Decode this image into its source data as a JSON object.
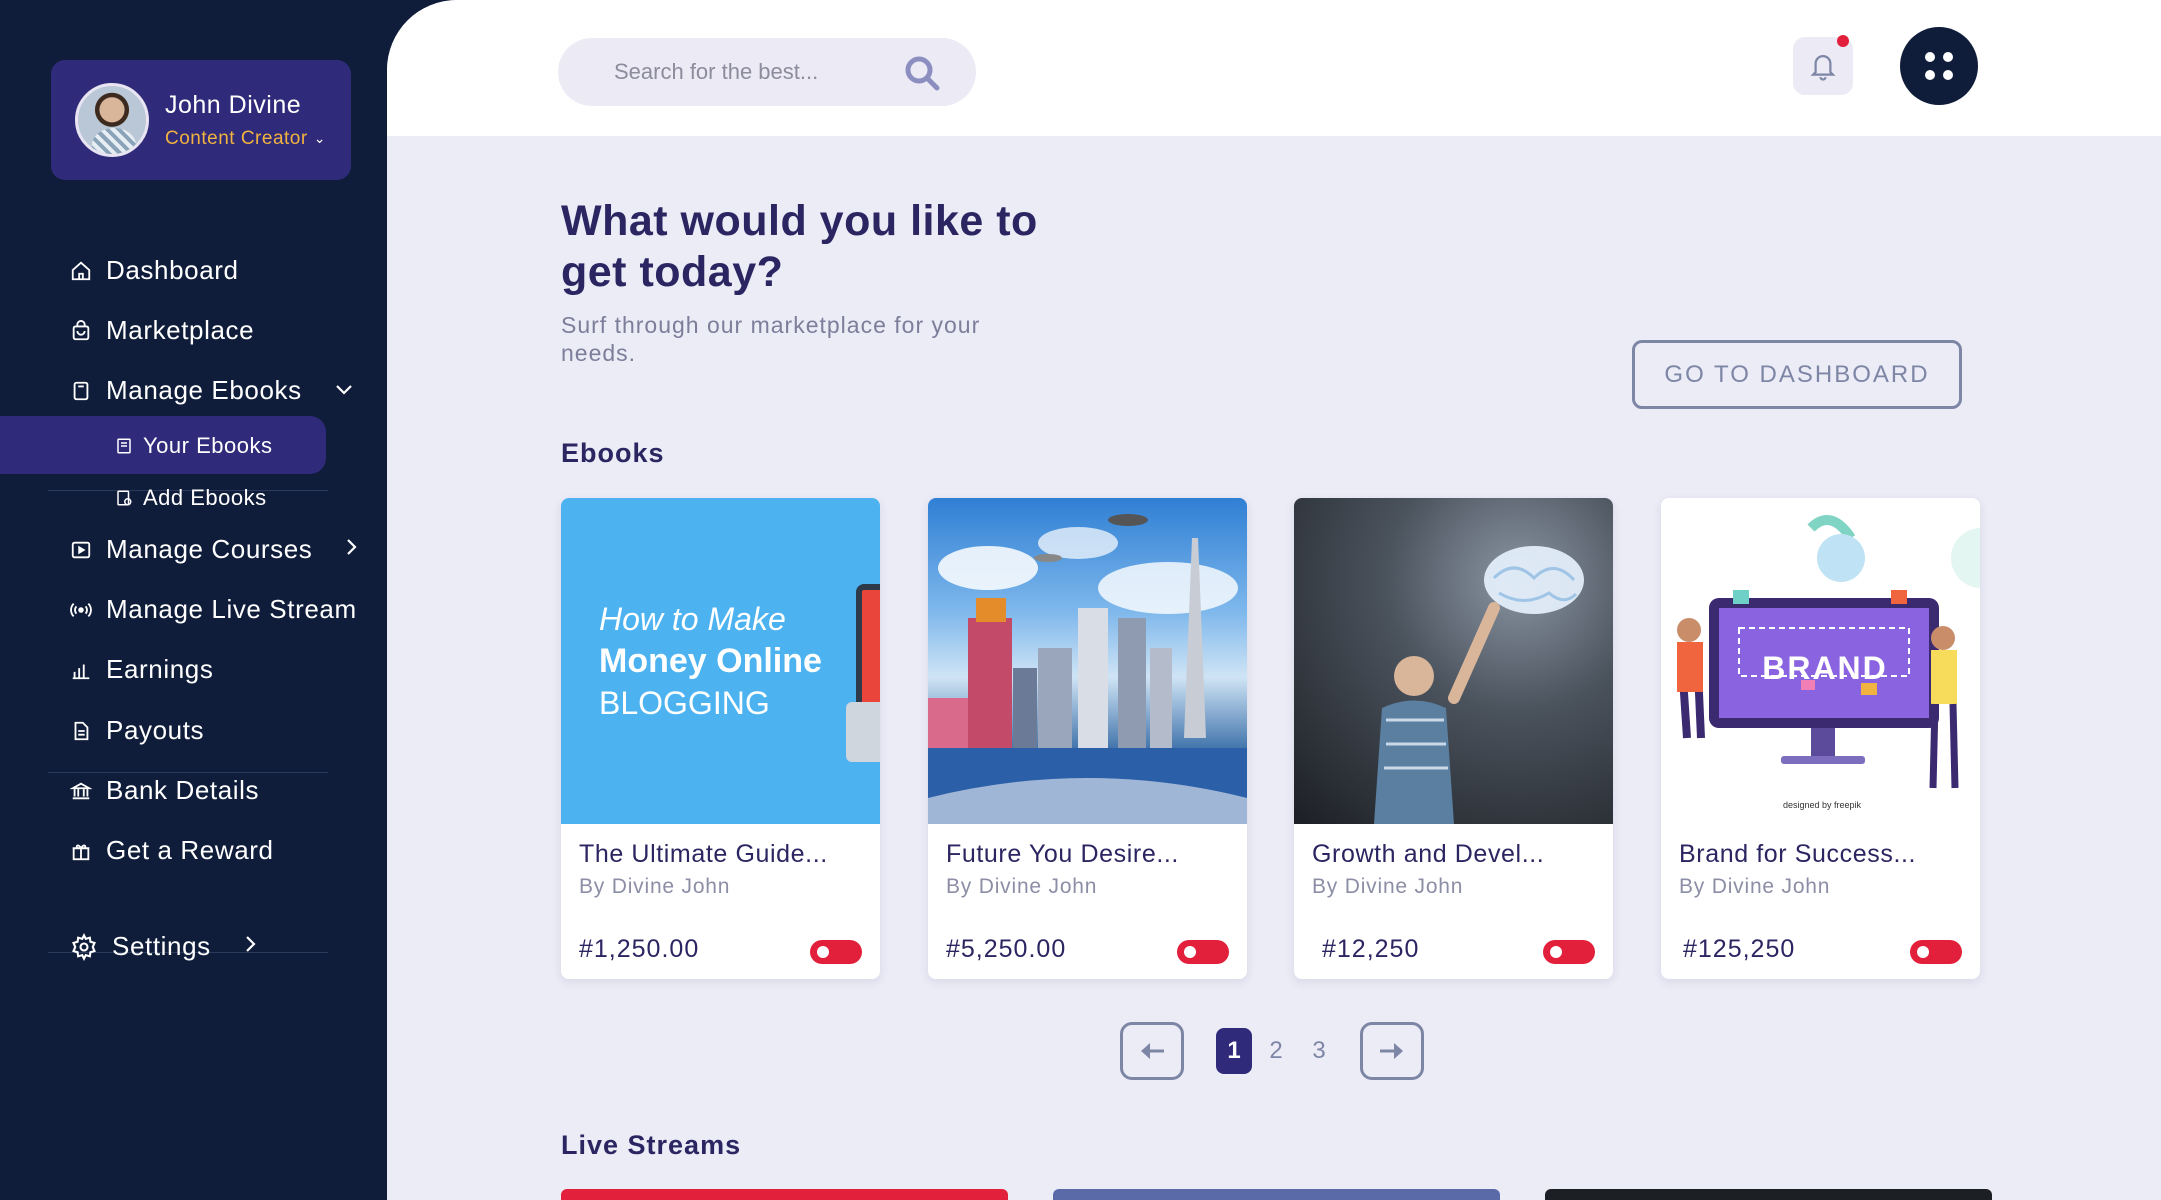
{
  "profile": {
    "name": "John Divine",
    "role": "Content Creator"
  },
  "nav": {
    "dashboard": "Dashboard",
    "marketplace": "Marketplace",
    "manage_ebooks": "Manage Ebooks",
    "your_ebooks": "Your Ebooks",
    "add_ebooks": "Add Ebooks",
    "manage_courses": "Manage Courses",
    "manage_live_stream": "Manage Live Stream",
    "earnings": "Earnings",
    "payouts": "Payouts",
    "bank_details": "Bank Details",
    "get_reward": "Get a Reward",
    "settings": "Settings"
  },
  "search": {
    "placeholder": "Search for the best..."
  },
  "hero": {
    "title": "What would you like to get today?",
    "subtitle": "Surf through our marketplace for your needs.",
    "cta": "GO TO DASHBOARD"
  },
  "ebooks": {
    "title": "Ebooks",
    "items": [
      {
        "title": "The Ultimate Guide...",
        "author": "By Divine John",
        "price": "#1,250.00",
        "cover_line1": "How to Make",
        "cover_line2": "Money Online",
        "cover_line3": "BLOGGING"
      },
      {
        "title": "Future You Desire...",
        "author": "By Divine John",
        "price": "#5,250.00"
      },
      {
        "title": "Growth and Devel...",
        "author": "By Divine John",
        "price": "#12,250"
      },
      {
        "title": "Brand for Success...",
        "author": "By Divine John",
        "price": "#125,250",
        "cover_brand": "BRAND",
        "cover_credit": "designed by freepik"
      }
    ]
  },
  "pagination": {
    "pages": [
      "1",
      "2",
      "3"
    ],
    "current": "1"
  },
  "live_streams": {
    "title": "Live Streams"
  },
  "colors": {
    "sidebar": "#0f1d3a",
    "accent": "#2f2b7a",
    "highlight": "#f1b23f",
    "toggle": "#e3203b",
    "background": "#ececf7"
  }
}
